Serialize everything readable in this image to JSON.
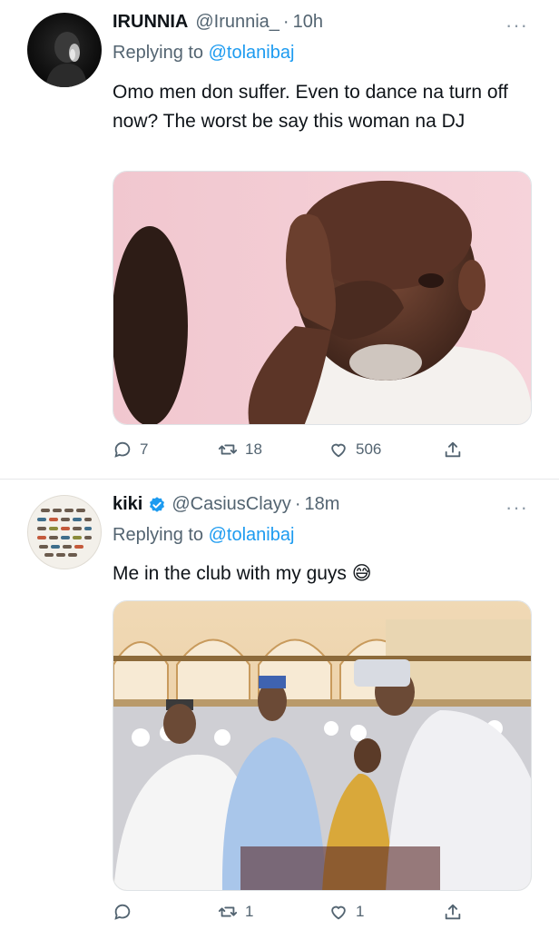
{
  "tweets": [
    {
      "name": "IRUNNIA",
      "handle": "@Irunnia_",
      "time": "10h",
      "reply_prefix": "Replying to",
      "reply_to": "@tolanibaj",
      "text": "Omo men don suffer. Even to dance na turn off now? The worst be say this woman na DJ",
      "stats": {
        "replies": "7",
        "retweets": "18",
        "likes": "506"
      },
      "media_icon": "man-face-palm-photo",
      "verified": false
    },
    {
      "name": "kiki",
      "handle": "@CasiusClayy",
      "time": "18m",
      "reply_prefix": "Replying to",
      "reply_to": "@tolanibaj",
      "text": "Me in the club with my guys",
      "emoji": "😅",
      "stats": {
        "replies": "",
        "retweets": "1",
        "likes": "1"
      },
      "media_icon": "mosque-crowd-photo",
      "verified": true
    }
  ],
  "dot_separator": "·",
  "more_glyph": "···",
  "colors": {
    "accent": "#1d9bf0",
    "muted": "#536471",
    "text": "#0f1419",
    "divider": "#e6e8ea"
  }
}
